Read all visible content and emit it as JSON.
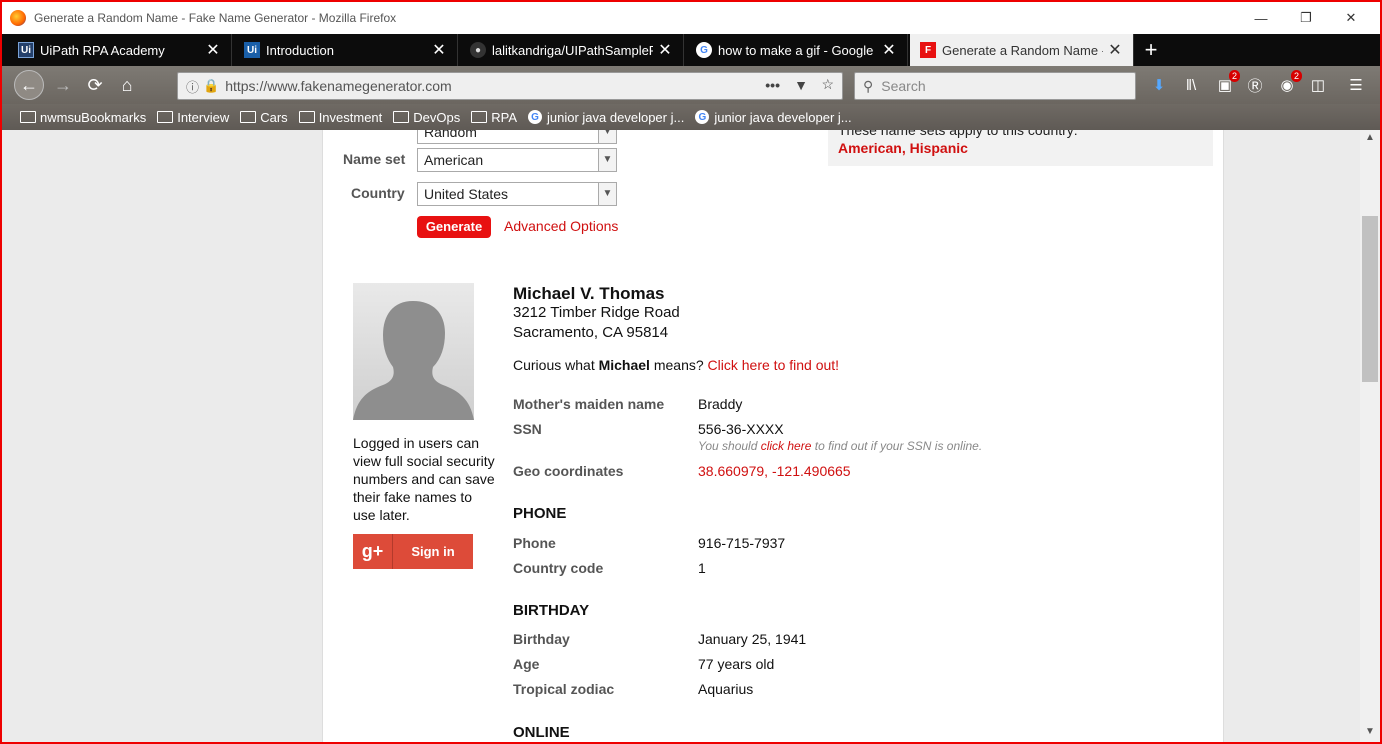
{
  "window": {
    "title": "Generate a Random Name - Fake Name Generator - Mozilla Firefox"
  },
  "tabs": [
    {
      "label": "UiPath RPA Academy",
      "icon": "uipath-icon"
    },
    {
      "label": "Introduction",
      "icon": "uipath-icon"
    },
    {
      "label": "lalitkandriga/UIPathSampleProj",
      "icon": "github-icon"
    },
    {
      "label": "how to make a gif - Google Sea",
      "icon": "google-icon"
    },
    {
      "label": "Generate a Random Name - Fa",
      "icon": "fakename-icon"
    }
  ],
  "nav": {
    "url": "https://www.fakenamegenerator.com",
    "search_placeholder": "Search",
    "badges": {
      "extension1": "2",
      "abp": "2"
    }
  },
  "bookmarks": [
    {
      "label": "nwmsuBookmarks",
      "type": "folder"
    },
    {
      "label": "Interview",
      "type": "folder"
    },
    {
      "label": "Cars",
      "type": "folder"
    },
    {
      "label": "Investment",
      "type": "folder"
    },
    {
      "label": "DevOps",
      "type": "folder"
    },
    {
      "label": "RPA",
      "type": "folder"
    },
    {
      "label": "junior java developer j...",
      "type": "google"
    },
    {
      "label": "junior java developer j...",
      "type": "google"
    }
  ],
  "form": {
    "gender_value": "Random",
    "nameset_label": "Name set",
    "nameset_value": "American",
    "country_label": "Country",
    "country_value": "United States",
    "generate_label": "Generate",
    "advanced_label": "Advanced Options",
    "nameset_note": "These name sets apply to this country:",
    "nameset_link1": "American",
    "nameset_link2": "Hispanic",
    "comma": ", "
  },
  "sidebar": {
    "logged_text": "Logged in users can view full social security numbers and can save their fake names to use later.",
    "gplus_icon": "g+",
    "signin_label": "Sign in"
  },
  "person": {
    "name": "Michael V. Thomas",
    "address_line1": "3212 Timber Ridge Road",
    "address_line2": "Sacramento, CA 95814",
    "curious_prefix": "Curious what ",
    "curious_name": "Michael",
    "curious_mid": " means? ",
    "curious_link": "Click here to find out!",
    "maiden_label": "Mother's maiden name",
    "maiden_value": "Braddy",
    "ssn_label": "SSN",
    "ssn_value": "556-36-XXXX",
    "ssn_note_prefix": "You should ",
    "ssn_note_link": "click here",
    "ssn_note_suffix": " to find out if your SSN is online.",
    "geo_label": "Geo coordinates",
    "geo_value": "38.660979, -121.490665",
    "phone_section": "PHONE",
    "phone_label": "Phone",
    "phone_value": "916-715-7937",
    "country_code_label": "Country code",
    "country_code_value": "1",
    "birthday_section": "BIRTHDAY",
    "birthday_label": "Birthday",
    "birthday_value": "January 25, 1941",
    "age_label": "Age",
    "age_value": "77 years old",
    "zodiac_label": "Tropical zodiac",
    "zodiac_value": "Aquarius",
    "online_section": "ONLINE"
  }
}
